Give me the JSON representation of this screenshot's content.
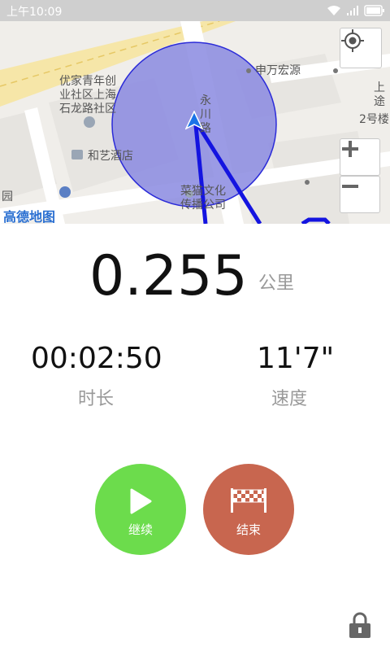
{
  "statusbar": {
    "time": "上午10:09",
    "icons": [
      "wifi-icon",
      "signal-icon",
      "battery-icon"
    ]
  },
  "map": {
    "labels": {
      "poi1": "优家青年创\n业社区上海\n石龙路社区",
      "hotel": "和艺酒店",
      "road": "永\n川\n路",
      "company": "菜猫文化\n传播公司",
      "building": "申万宏源",
      "bldg2": "2号楼",
      "edge_char": "上\n途",
      "park_char": "园"
    },
    "brand": "高德地图",
    "accuracy_circle_color": "#8080dd",
    "track_color": "#1414e0"
  },
  "stats": {
    "distance": "0.255",
    "distance_unit": "公里",
    "duration": "00:02:50",
    "duration_label": "时长",
    "pace": "11'7\"",
    "pace_label": "速度"
  },
  "actions": {
    "resume_label": "继续",
    "resume_color": "#6cdc4c",
    "end_label": "结束",
    "end_color": "#c8664f"
  }
}
